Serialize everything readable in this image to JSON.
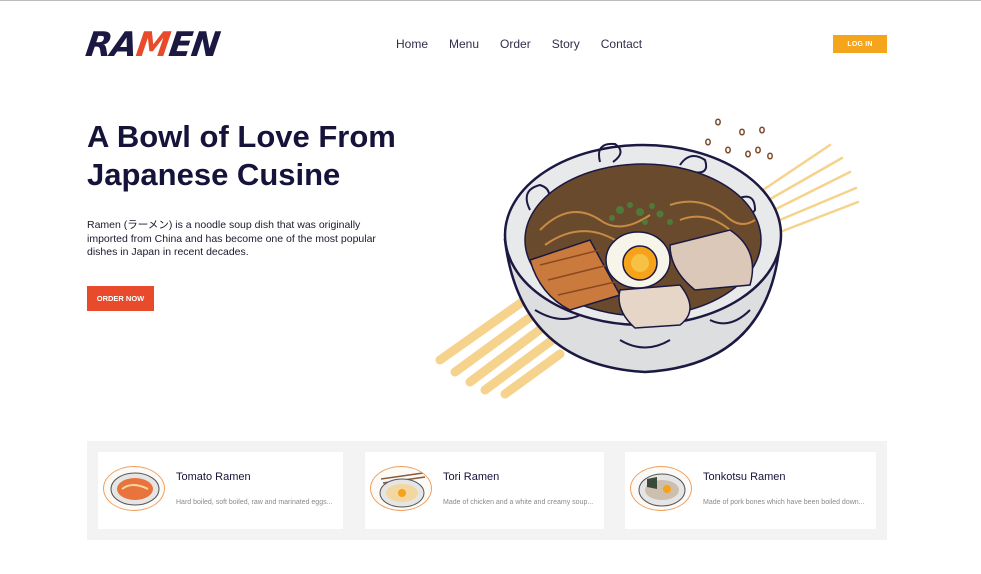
{
  "brand": {
    "logo_text_a": "RA",
    "logo_text_m": "M",
    "logo_text_b": "EN"
  },
  "nav": [
    {
      "label": "Home"
    },
    {
      "label": "Menu"
    },
    {
      "label": "Order"
    },
    {
      "label": "Story"
    },
    {
      "label": "Contact"
    }
  ],
  "login_label": "LOG IN",
  "hero": {
    "title_line1": "A Bowl of Love From",
    "title_line2": "Japanese Cusine",
    "description": "Ramen (ラーメン) is a noodle soup dish that was originally imported from China and has become one of the most popular dishes in Japan in recent decades.",
    "cta_label": "ORDER NOW"
  },
  "menu_items": [
    {
      "name": "Tomato Ramen",
      "description": "Hard boiled, soft boiled, raw and marinated eggs..."
    },
    {
      "name": "Tori Ramen",
      "description": "Made of chicken and a white and creamy soup..."
    },
    {
      "name": "Tonkotsu Ramen",
      "description": "Made of pork bones which have been boiled down..."
    }
  ],
  "colors": {
    "primary_dark": "#15133a",
    "accent_red": "#e84b2c",
    "accent_yellow": "#f4a51c",
    "band_gray": "#f3f3f3"
  }
}
